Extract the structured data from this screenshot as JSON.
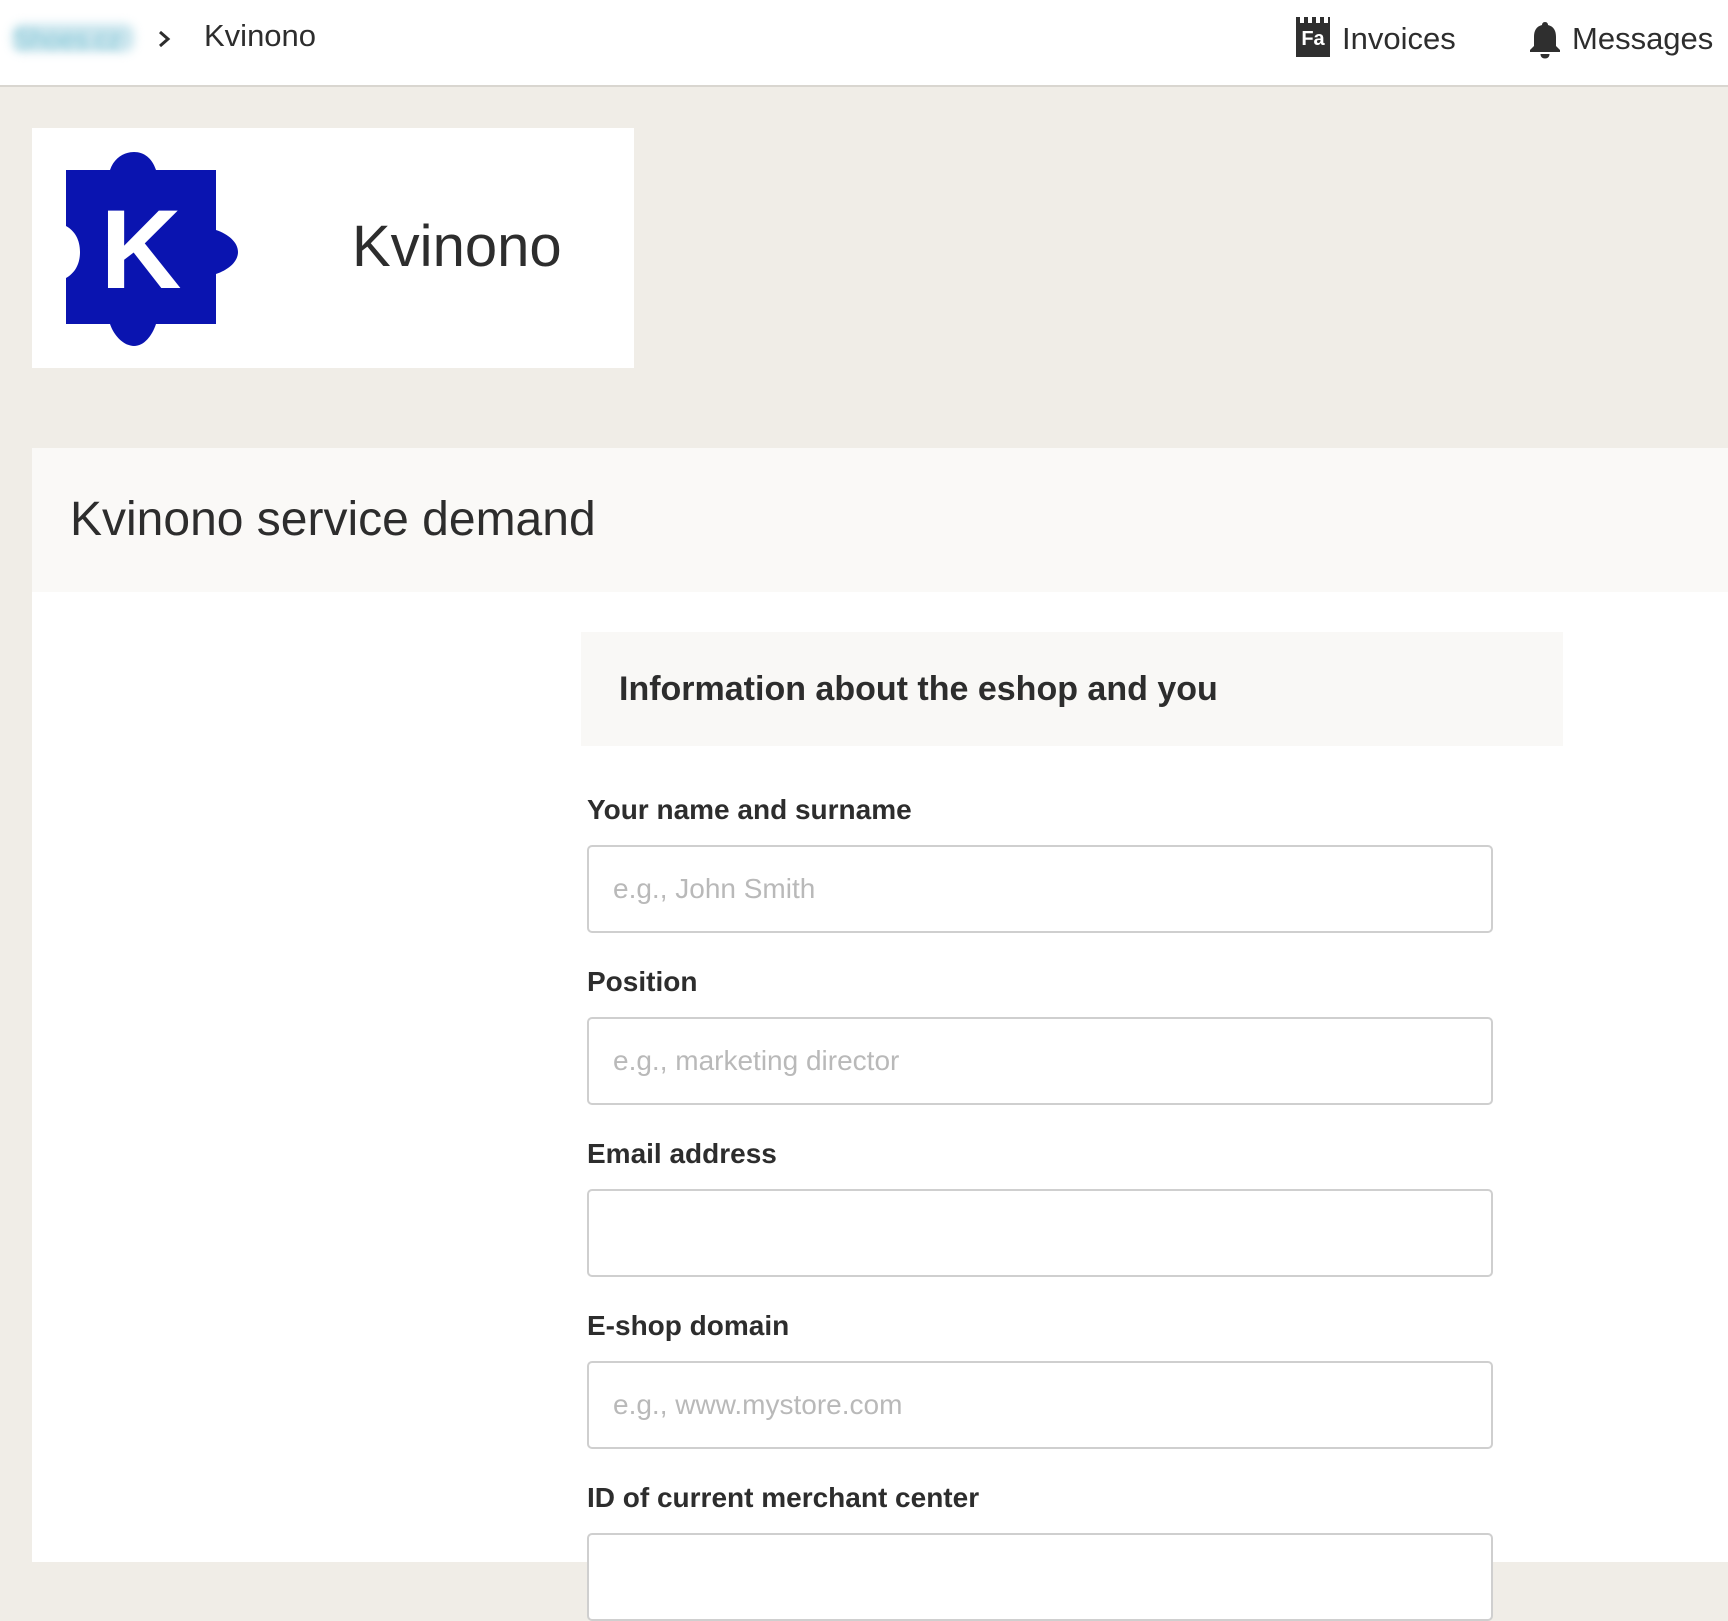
{
  "topbar": {
    "breadcrumb_root": "Shoes.cz",
    "breadcrumb_current": "Kvinono",
    "invoices_label": "Invoices",
    "invoices_icon_text": "Fa",
    "messages_label": "Messages"
  },
  "brand": {
    "logo_letter": "K",
    "logo_color": "#0a14b0",
    "name": "Kvinono"
  },
  "page": {
    "title": "Kvinono service demand"
  },
  "form": {
    "section_title": "Information about the eshop and you",
    "fields": [
      {
        "label": "Your name and surname",
        "placeholder": "e.g., John Smith",
        "value": ""
      },
      {
        "label": "Position",
        "placeholder": "e.g., marketing director",
        "value": ""
      },
      {
        "label": "Email address",
        "placeholder": "",
        "value": ""
      },
      {
        "label": "E-shop domain",
        "placeholder": "e.g., www.mystore.com",
        "value": ""
      },
      {
        "label": "ID of current merchant center",
        "placeholder": "",
        "value": ""
      }
    ]
  }
}
